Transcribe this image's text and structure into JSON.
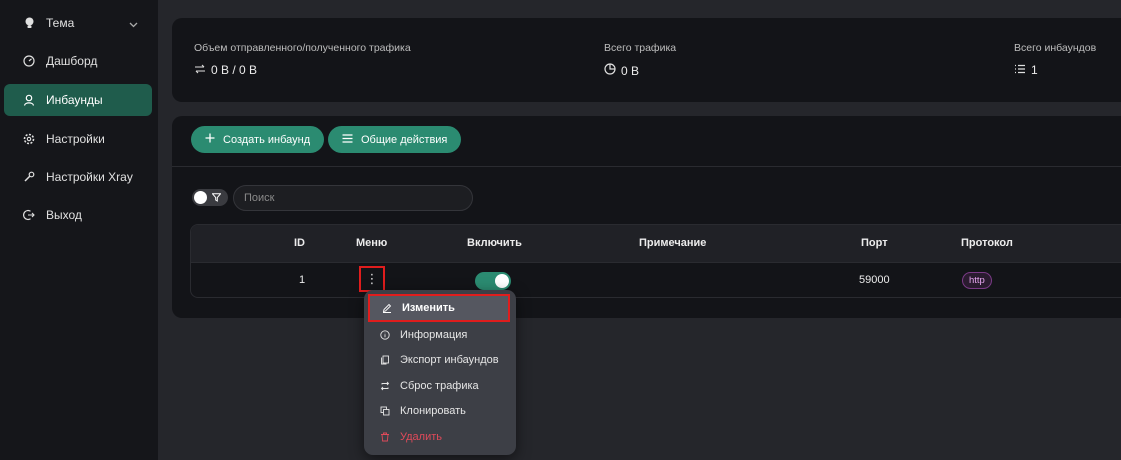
{
  "sidebar": {
    "items": [
      {
        "label": "Тема",
        "icon": "bulb-icon"
      },
      {
        "label": "Дашборд",
        "icon": "dashboard-icon"
      },
      {
        "label": "Инбаунды",
        "icon": "user-icon"
      },
      {
        "label": "Настройки",
        "icon": "gear-icon"
      },
      {
        "label": "Настройки Xray",
        "icon": "wrench-icon"
      },
      {
        "label": "Выход",
        "icon": "logout-icon"
      }
    ]
  },
  "stats": {
    "traffic_label": "Объем отправленного/полученного трафика",
    "traffic_value": "0 B / 0 B",
    "total_label": "Всего трафика",
    "total_value": "0 B",
    "inbounds_label": "Всего инбаундов",
    "inbounds_value": "1"
  },
  "toolbar": {
    "create_label": "Создать инбаунд",
    "actions_label": "Общие действия"
  },
  "search": {
    "placeholder": "Поиск"
  },
  "table": {
    "headers": {
      "id": "ID",
      "menu": "Меню",
      "enable": "Включить",
      "remark": "Примечание",
      "port": "Порт",
      "protocol": "Протокол"
    },
    "rows": [
      {
        "id": "1",
        "menu": "⋮",
        "enabled": true,
        "remark": "",
        "port": "59000",
        "protocol": "http"
      }
    ]
  },
  "dropdown": {
    "items": [
      {
        "label": "Изменить",
        "icon": "edit-icon"
      },
      {
        "label": "Информация",
        "icon": "info-icon"
      },
      {
        "label": "Экспорт инбаундов",
        "icon": "copy-icon"
      },
      {
        "label": "Сброс трафика",
        "icon": "retweet-icon"
      },
      {
        "label": "Клонировать",
        "icon": "clone-icon"
      },
      {
        "label": "Удалить",
        "icon": "delete-icon"
      }
    ]
  },
  "colors": {
    "accent": "#2b8b71",
    "sidebar_active": "#1f5c4c",
    "danger": "#e04a5a",
    "highlight_border": "#e01d1d"
  }
}
